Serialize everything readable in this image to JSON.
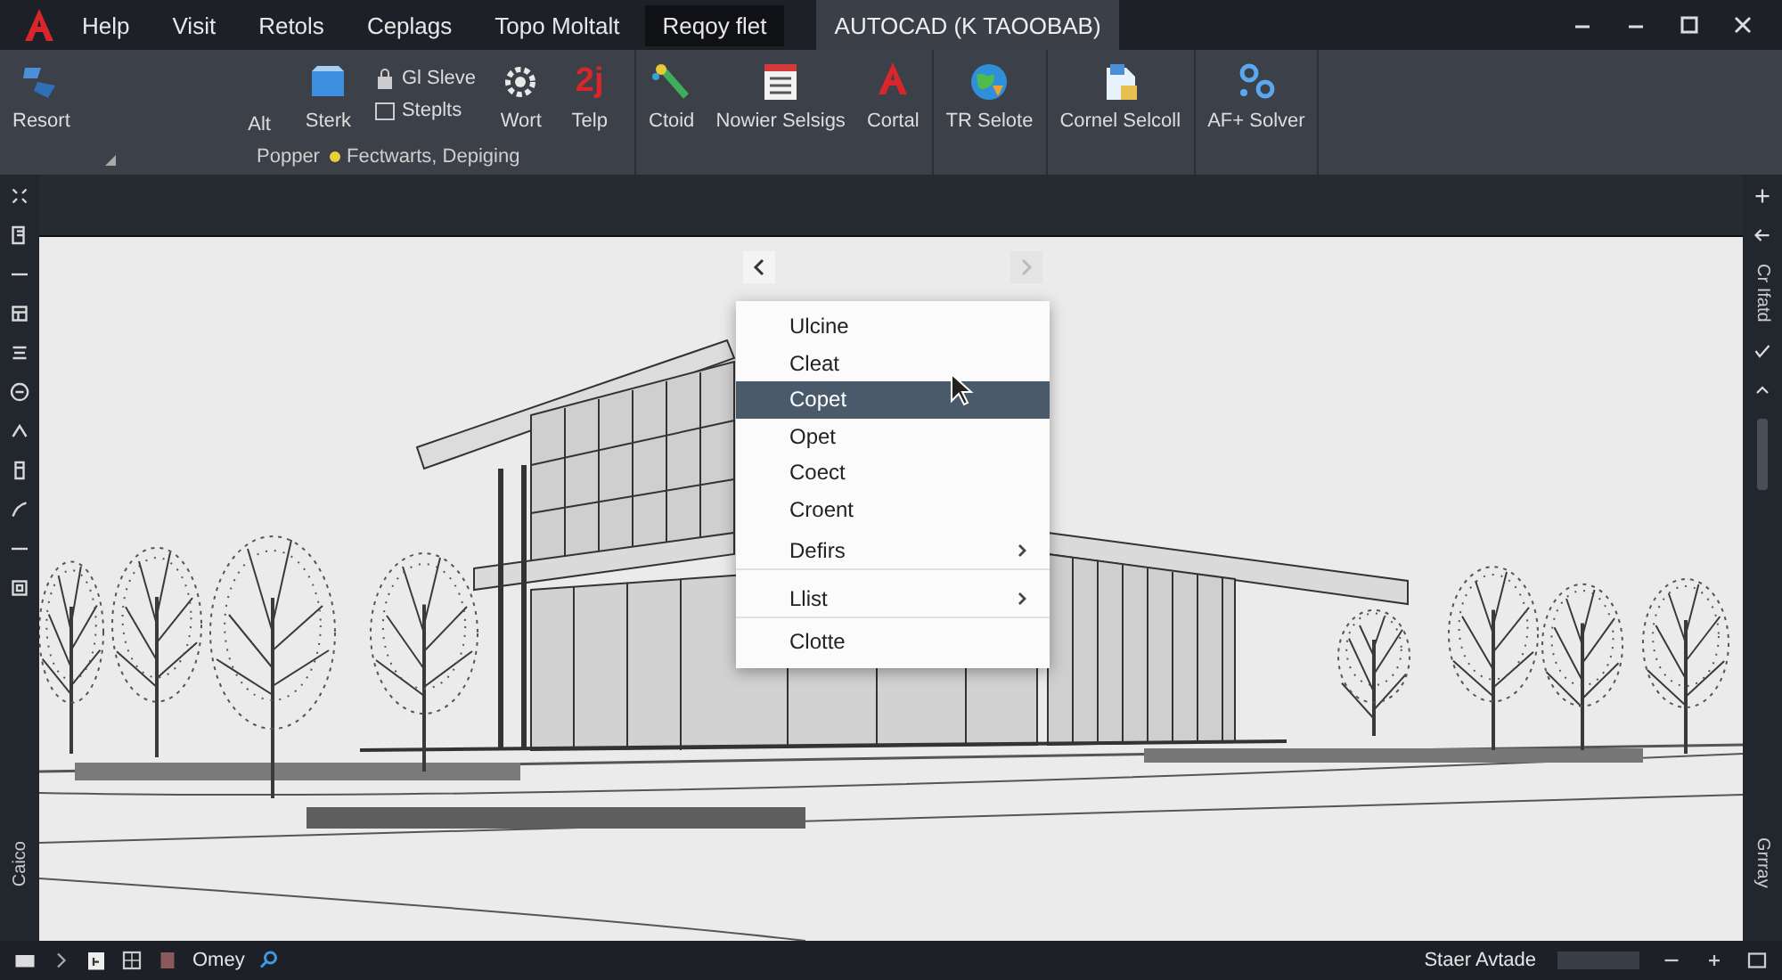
{
  "menu_bar": {
    "items": [
      {
        "label": "Help",
        "selected": false
      },
      {
        "label": "Visit",
        "selected": false
      },
      {
        "label": "Retols",
        "selected": false
      },
      {
        "label": "Ceplags",
        "selected": false
      },
      {
        "label": "Topo Moltalt",
        "selected": false
      },
      {
        "label": "Reqoy flet",
        "selected": true
      }
    ],
    "document_tab": "AUTOCAD (K TAOOBAB)"
  },
  "ribbon": {
    "groups": [
      {
        "items": [
          {
            "kind": "large",
            "label": "Resort"
          },
          {
            "kind": "label",
            "label": "Alt"
          },
          {
            "kind": "large",
            "label": "Sterk"
          },
          {
            "kind": "stack",
            "items": [
              {
                "label": "Gl Sleve"
              },
              {
                "label": "Steplts"
              }
            ]
          },
          {
            "kind": "large",
            "label": "Wort"
          },
          {
            "kind": "glyph",
            "glyph": "2j",
            "label": "Telp"
          }
        ],
        "labels": [
          {
            "text": "Popper",
            "dot": false
          },
          {
            "text": "Fectwarts, Depiging",
            "dot": true
          }
        ]
      },
      {
        "items": [
          {
            "kind": "large",
            "label": "Ctoid"
          },
          {
            "kind": "large",
            "label": "Nowier Selsigs"
          },
          {
            "kind": "large",
            "label": "Cortal"
          }
        ]
      },
      {
        "items": [
          {
            "kind": "large",
            "label": "TR Selote"
          }
        ]
      },
      {
        "items": [
          {
            "kind": "large",
            "label": "Cornel Selcoll"
          }
        ]
      },
      {
        "items": [
          {
            "kind": "large",
            "label": "AF+ Solver"
          }
        ]
      }
    ]
  },
  "side_texts": {
    "left": "Caico",
    "right_top": "Cr Ifatd",
    "right_bottom": "Grrray"
  },
  "context_menu": {
    "items": [
      {
        "label": "Ulcine",
        "selected": false,
        "submenu": false,
        "divider_after": false
      },
      {
        "label": "Cleat",
        "selected": false,
        "submenu": false,
        "divider_after": false
      },
      {
        "label": "Copet",
        "selected": true,
        "submenu": false,
        "divider_after": false
      },
      {
        "label": "Opet",
        "selected": false,
        "submenu": false,
        "divider_after": false
      },
      {
        "label": "Coect",
        "selected": false,
        "submenu": false,
        "divider_after": false
      },
      {
        "label": "Croent",
        "selected": false,
        "submenu": false,
        "divider_after": false
      },
      {
        "label": "Defirs",
        "selected": false,
        "submenu": true,
        "divider_after": true
      },
      {
        "label": "Llist",
        "selected": false,
        "submenu": true,
        "divider_after": true
      },
      {
        "label": "Clotte",
        "selected": false,
        "submenu": false,
        "divider_after": false
      }
    ]
  },
  "status_bar": {
    "left_label": "Omey",
    "right_label": "Staer Avtade"
  }
}
